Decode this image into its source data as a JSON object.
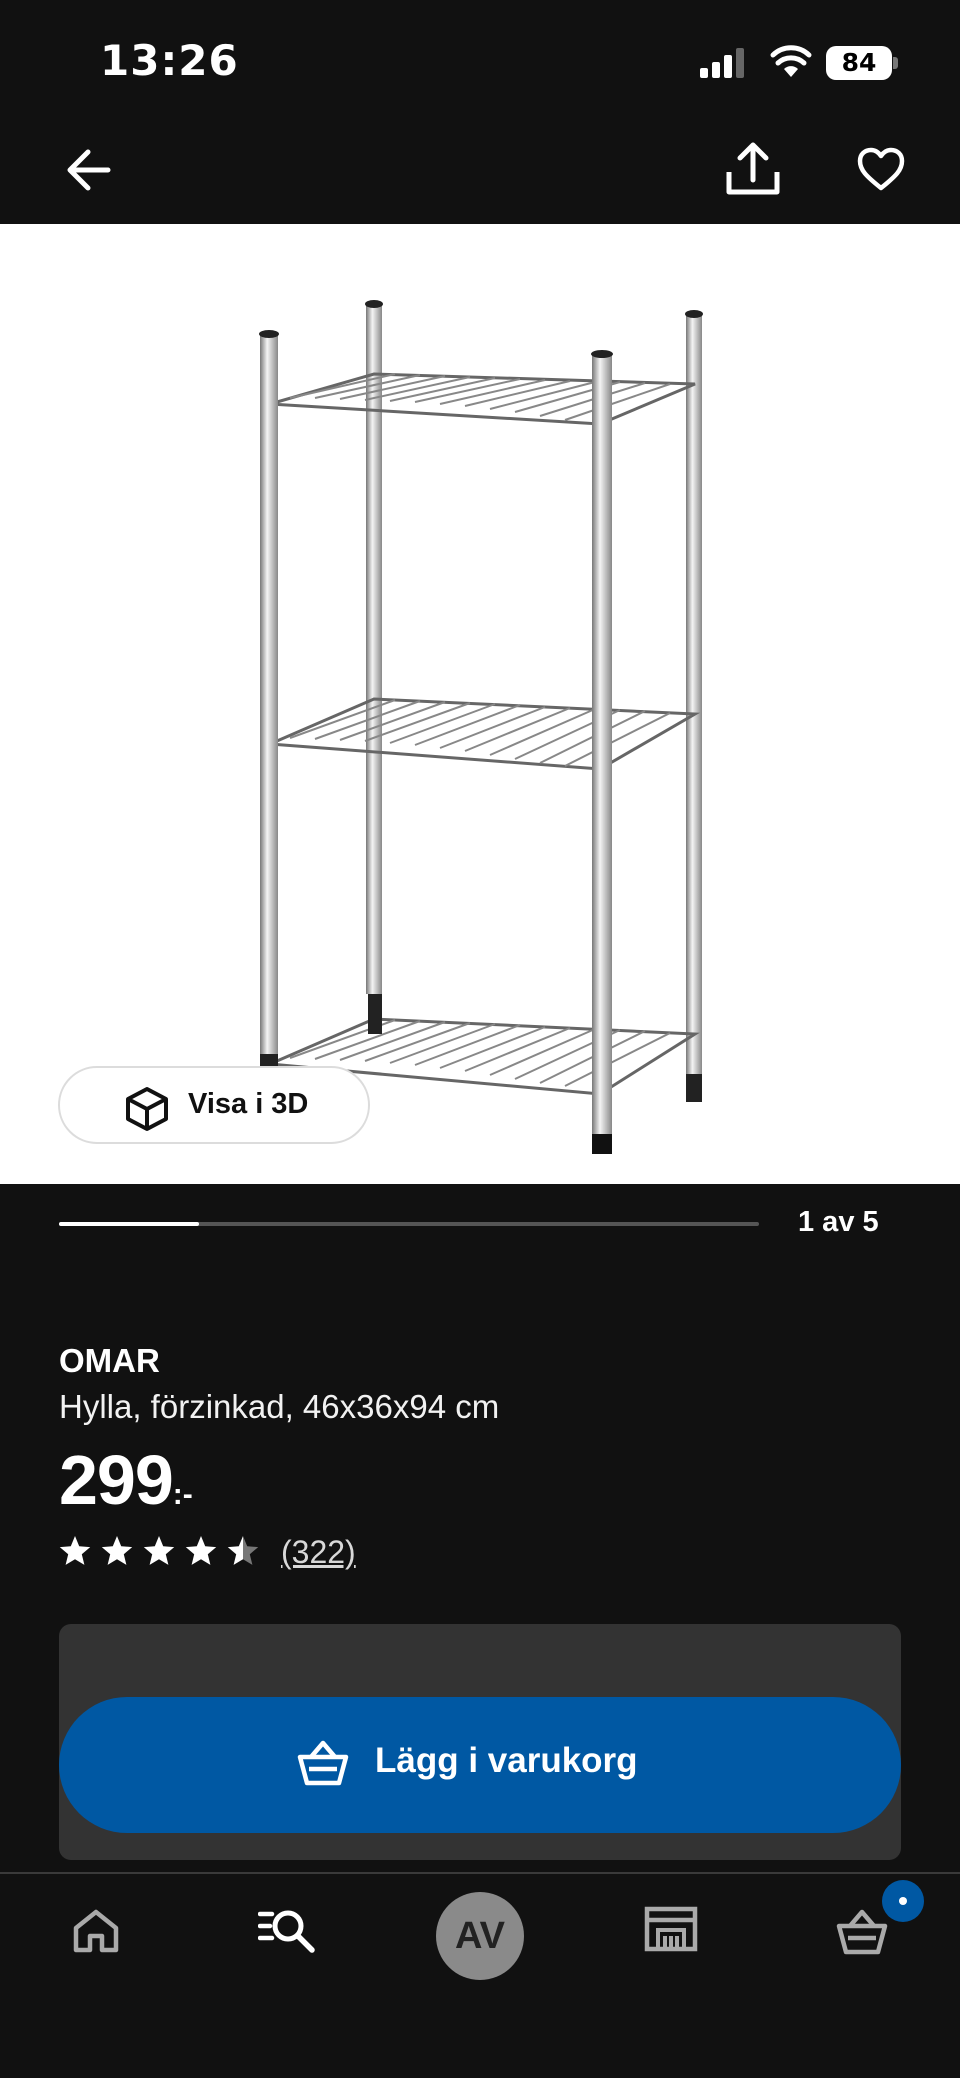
{
  "status_bar": {
    "time": "13:26",
    "battery": "84"
  },
  "hero": {
    "view_3d_label": "Visa i 3D",
    "pager": "1 av 5",
    "progress": 0.2
  },
  "product": {
    "name": "OMAR",
    "description": "Hylla, förzinkad, 46x36x94 cm",
    "price_integer": "299",
    "price_suffix": ":-",
    "rating_stars": 4.5,
    "review_count": "(322)"
  },
  "cart": {
    "add_to_cart_label": "Lägg i varukorg"
  },
  "bottom_nav": {
    "avatar_initials": "AV"
  },
  "colors": {
    "background": "#111111",
    "accent": "#0058a3",
    "panel": "#333333"
  },
  "icons": [
    "signal-icon",
    "wifi-icon",
    "battery-icon",
    "back-arrow-icon",
    "share-icon",
    "heart-icon",
    "cube-3d-icon",
    "star-icon",
    "basket-icon",
    "home-icon",
    "search-icon",
    "store-icon",
    "cart-icon"
  ]
}
